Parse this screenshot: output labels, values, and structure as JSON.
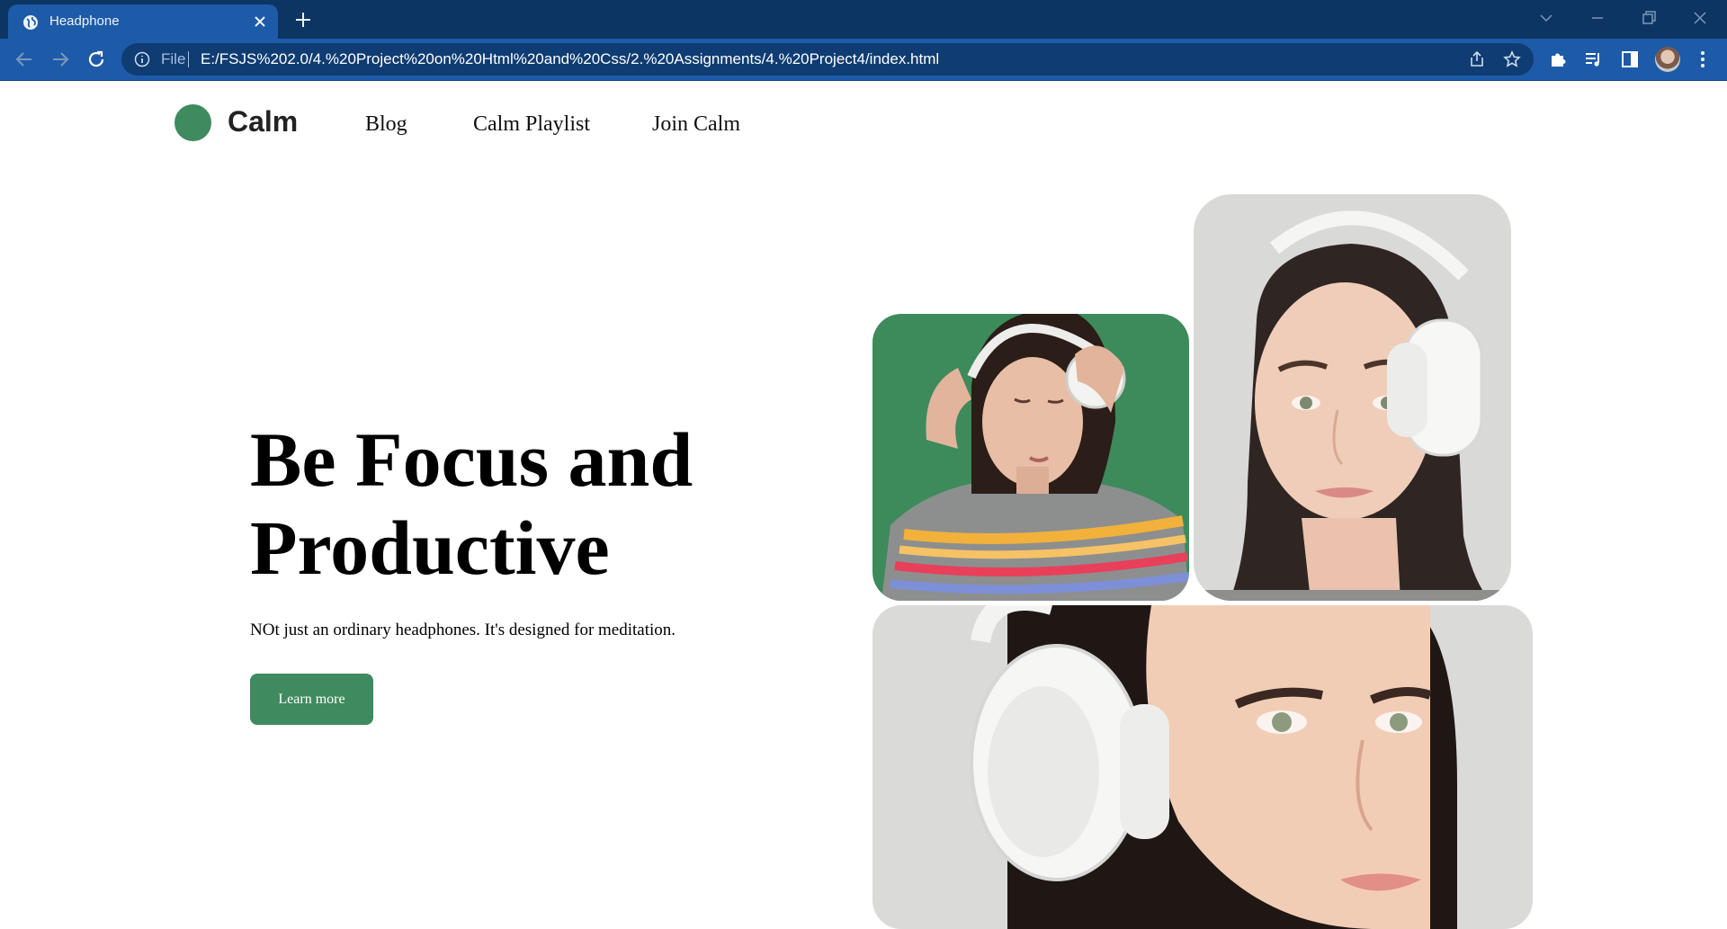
{
  "browser": {
    "tab_title": "Headphone",
    "scheme_label": "File",
    "url": "E:/FSJS%202.0/4.%20Project%20on%20Html%20and%20Css/2.%20Assignments/4.%20Project4/index.html",
    "icons": [
      "globe-icon",
      "close-icon",
      "plus-icon",
      "chevron-down-icon",
      "minimize-icon",
      "restore-icon",
      "window-close-icon",
      "back-arrow-icon",
      "forward-arrow-icon",
      "reload-icon",
      "info-icon",
      "share-icon",
      "star-icon",
      "puzzle-icon",
      "media-queue-icon",
      "side-panel-icon",
      "avatar"
    ]
  },
  "site": {
    "logo": "Calm",
    "nav": [
      "Blog",
      "Calm Playlist",
      "Join Calm"
    ]
  },
  "hero": {
    "title": "Be Focus and Productive",
    "subtitle": "NOt just an ordinary headphones. It's designed for meditation.",
    "cta_label": "Learn more"
  },
  "colors": {
    "accent": "#3f8a5f",
    "tabstrip": "#0d3563",
    "toolbar": "#1d5ba8"
  }
}
